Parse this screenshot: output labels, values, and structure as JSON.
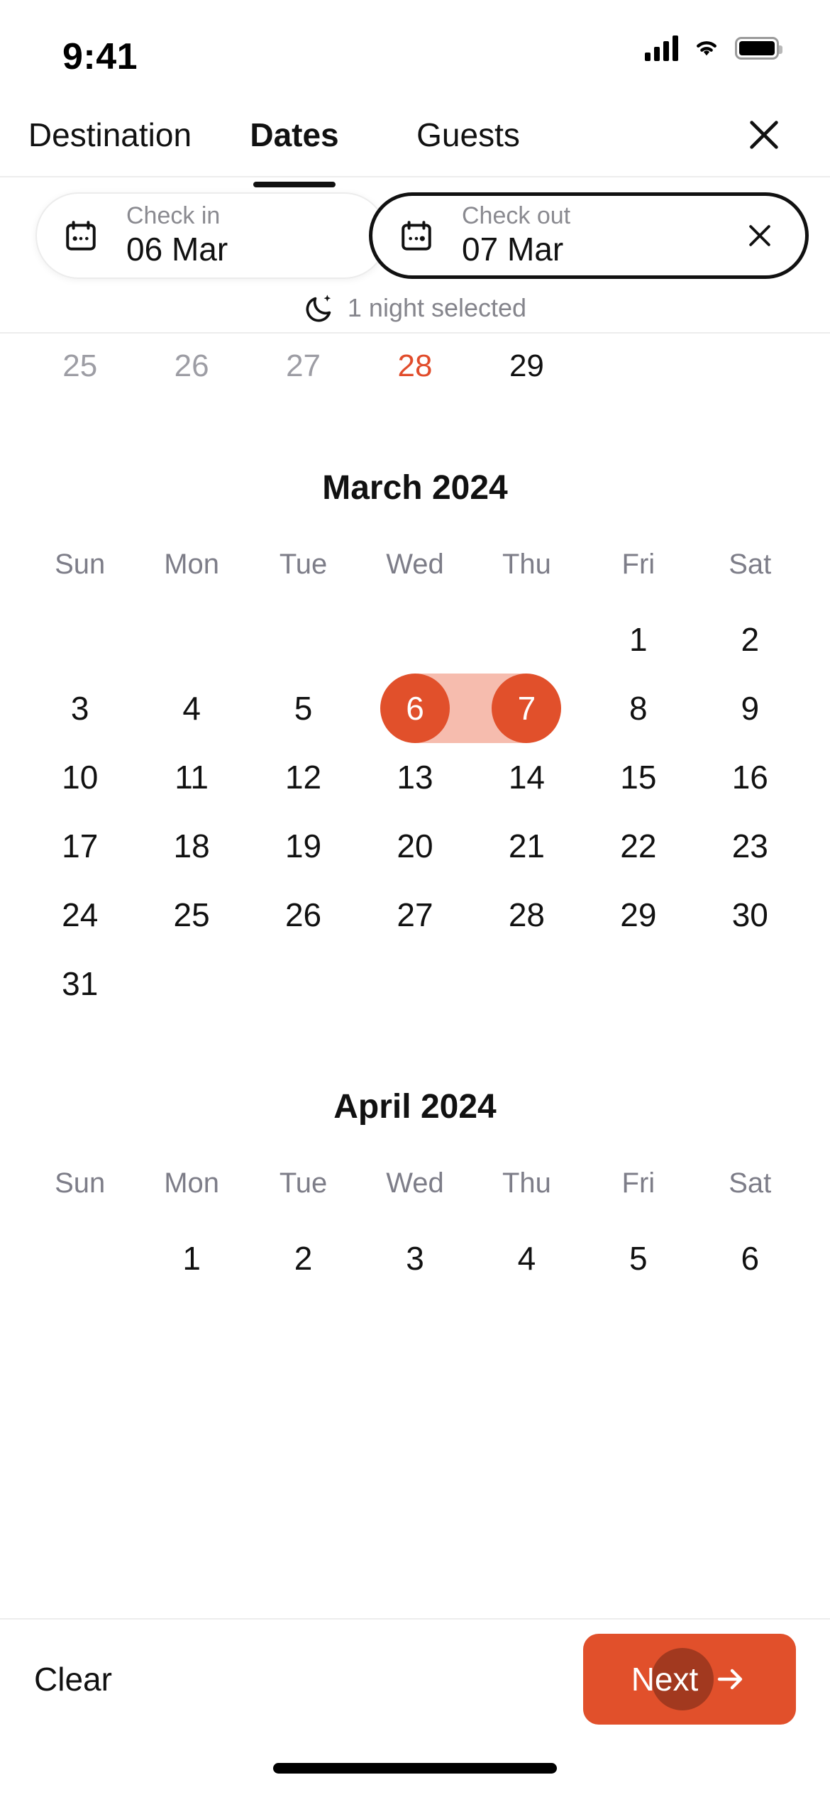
{
  "status_bar": {
    "time": "9:41",
    "signal_icon": "cellular-signal-icon",
    "wifi_icon": "wifi-icon",
    "battery_icon": "battery-icon"
  },
  "header": {
    "tabs": [
      {
        "label": "Destination",
        "active": false
      },
      {
        "label": "Dates",
        "active": true
      },
      {
        "label": "Guests",
        "active": false
      }
    ],
    "close_icon": "close-icon"
  },
  "date_fields": {
    "check_in": {
      "label": "Check in",
      "value": "06 Mar",
      "icon": "calendar-icon",
      "active": false
    },
    "check_out": {
      "label": "Check out",
      "value": "07 Mar",
      "icon": "calendar-icon",
      "clear_icon": "close-icon",
      "active": true
    }
  },
  "nights_summary": {
    "icon": "moon-sparkle-icon",
    "text": "1 night selected"
  },
  "previous_month_row": {
    "days": [
      {
        "label": "25",
        "state": "past"
      },
      {
        "label": "26",
        "state": "past"
      },
      {
        "label": "27",
        "state": "past"
      },
      {
        "label": "28",
        "state": "today"
      },
      {
        "label": "29",
        "state": "normal"
      }
    ]
  },
  "months": [
    {
      "title": "March 2024",
      "weekdays": [
        "Sun",
        "Mon",
        "Tue",
        "Wed",
        "Thu",
        "Fri",
        "Sat"
      ],
      "lead_blanks": 5,
      "days": [
        {
          "label": "1"
        },
        {
          "label": "2"
        },
        {
          "label": "3"
        },
        {
          "label": "4"
        },
        {
          "label": "5"
        },
        {
          "label": "6",
          "state": "range-start"
        },
        {
          "label": "7",
          "state": "range-end"
        },
        {
          "label": "8"
        },
        {
          "label": "9"
        },
        {
          "label": "10"
        },
        {
          "label": "11"
        },
        {
          "label": "12"
        },
        {
          "label": "13"
        },
        {
          "label": "14"
        },
        {
          "label": "15"
        },
        {
          "label": "16"
        },
        {
          "label": "17"
        },
        {
          "label": "18"
        },
        {
          "label": "19"
        },
        {
          "label": "20"
        },
        {
          "label": "21"
        },
        {
          "label": "22"
        },
        {
          "label": "23"
        },
        {
          "label": "24"
        },
        {
          "label": "25"
        },
        {
          "label": "26"
        },
        {
          "label": "27"
        },
        {
          "label": "28"
        },
        {
          "label": "29"
        },
        {
          "label": "30"
        },
        {
          "label": "31"
        }
      ]
    },
    {
      "title": "April 2024",
      "weekdays": [
        "Sun",
        "Mon",
        "Tue",
        "Wed",
        "Thu",
        "Fri",
        "Sat"
      ],
      "lead_blanks": 1,
      "days": [
        {
          "label": "1"
        },
        {
          "label": "2"
        },
        {
          "label": "3"
        },
        {
          "label": "4"
        },
        {
          "label": "5"
        },
        {
          "label": "6"
        }
      ]
    }
  ],
  "footer": {
    "clear_label": "Clear",
    "next_label": "Next",
    "next_icon": "arrow-right-icon"
  },
  "colors": {
    "accent": "#E1502B",
    "range_band": "#F6BCAE",
    "today": "#E14C2B",
    "muted_text": "#8a8a90",
    "primary_text": "#111111"
  }
}
